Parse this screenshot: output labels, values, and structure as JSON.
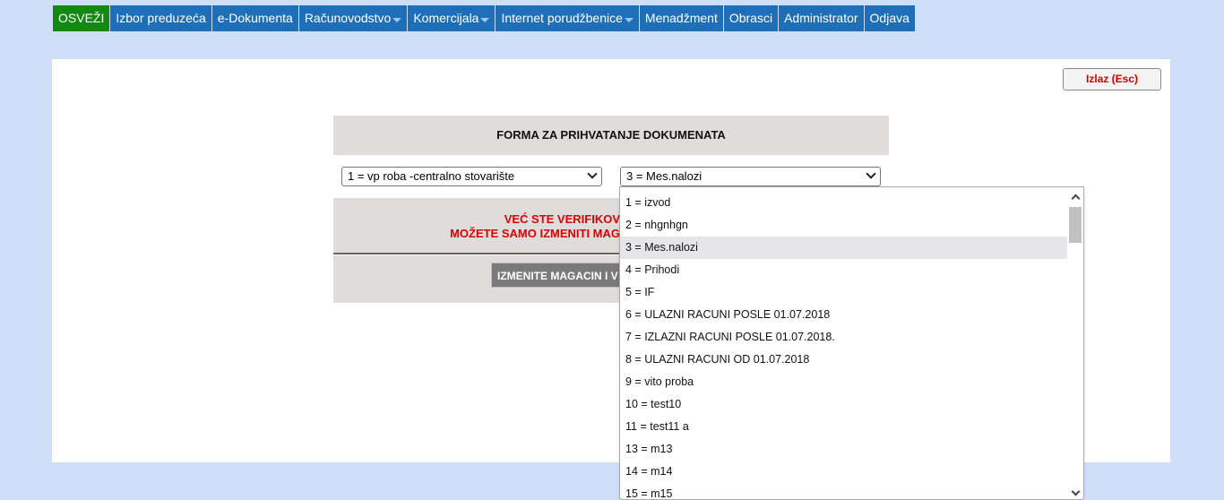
{
  "nav": {
    "items": [
      {
        "label": "OSVEŽI",
        "dropdown": false
      },
      {
        "label": "Izbor preduzeća",
        "dropdown": false
      },
      {
        "label": "e-Dokumenta",
        "dropdown": false
      },
      {
        "label": "Računovodstvo",
        "dropdown": true
      },
      {
        "label": "Komercijala",
        "dropdown": true
      },
      {
        "label": "Internet porudžbenice",
        "dropdown": true
      },
      {
        "label": "Menadžment",
        "dropdown": false
      },
      {
        "label": "Obrasci",
        "dropdown": false
      },
      {
        "label": "Administrator",
        "dropdown": false
      },
      {
        "label": "Odjava",
        "dropdown": false
      }
    ]
  },
  "exit_button": "Izlaz (Esc)",
  "form_title": "FORMA ZA PRIHVATANJE DOKUMENATA",
  "warehouse_select": {
    "value": "1 = vp roba -centralno stovarište"
  },
  "document_select": {
    "value": "3 = Mes.nalozi",
    "options": [
      "1 = izvod",
      "2 = nhgnhgn",
      "3 = Mes.nalozi",
      "4 = Prihodi",
      "5 = IF",
      "6 = ULAZNI RACUNI POSLE 01.07.2018",
      "7 = IZLAZNI RACUNI POSLE 01.07.2018.",
      "8 = ULAZNI RACUNI OD 01.07.2018",
      "9 = vito proba",
      "10 = test10",
      "11 = test11 a",
      "13 = m13",
      "14 = m14",
      "15 = m15"
    ],
    "selected_index": 2
  },
  "message": {
    "line1": "VEĆ STE VERIFIKOV",
    "line2": "MOŽETE SAMO IZMENITI MAG"
  },
  "action_button": "IZMENITE MAGACIN I V",
  "colors": {
    "page_bg": "#cfdff8",
    "nav_bg": "#1f6fb8",
    "refresh_bg": "#128a12",
    "message": "#e00000"
  }
}
